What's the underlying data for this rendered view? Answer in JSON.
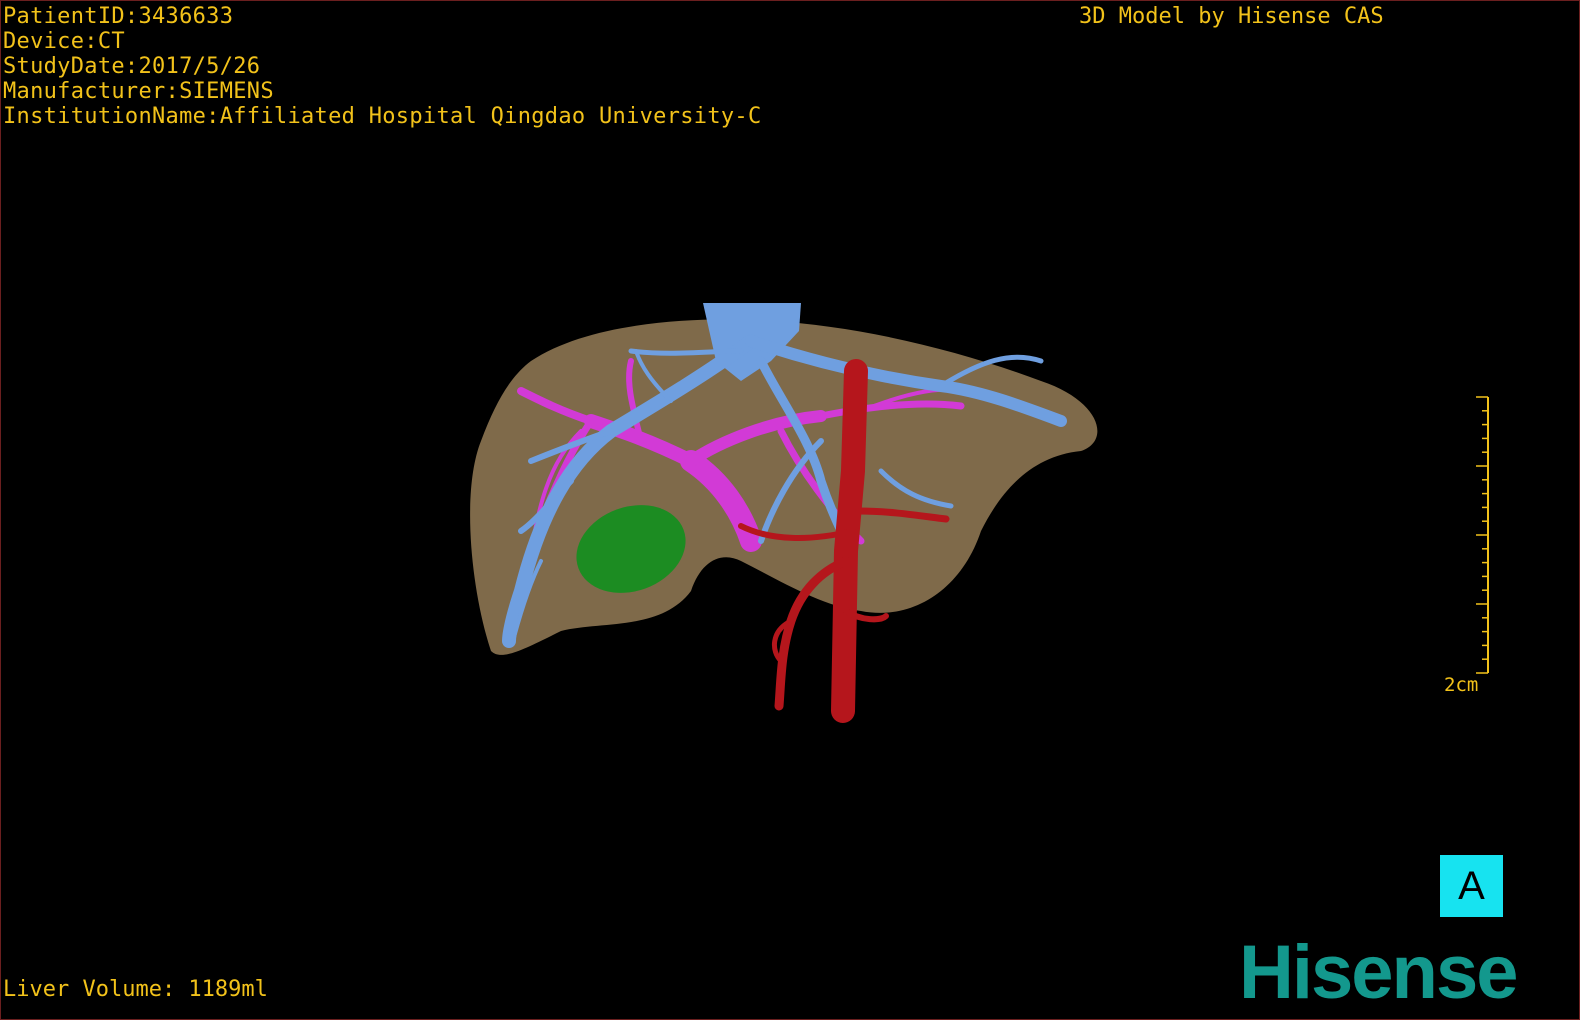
{
  "overlay": {
    "patient_id": "PatientID:3436633",
    "device": "Device:CT",
    "study_date": "StudyDate:2017/5/26",
    "manufacturer": "Manufacturer:SIEMENS",
    "institution": "InstitutionName:Affiliated Hospital Qingdao University-C",
    "model_credit": "3D Model by Hisense CAS",
    "liver_volume": "Liver Volume: 1189ml"
  },
  "scale": {
    "label": "2cm"
  },
  "orientation": {
    "label": "A"
  },
  "brand": {
    "name": "Hisense"
  },
  "colors": {
    "text": "#f2c21a",
    "liver": "#8a7350",
    "hepatic_vein": "#6f9fe0",
    "portal_vein": "#d23ad6",
    "artery": "#b5161c",
    "gallbladder": "#1c8c22",
    "orientation_bg": "#17e3f0",
    "brand": "#13988d"
  }
}
